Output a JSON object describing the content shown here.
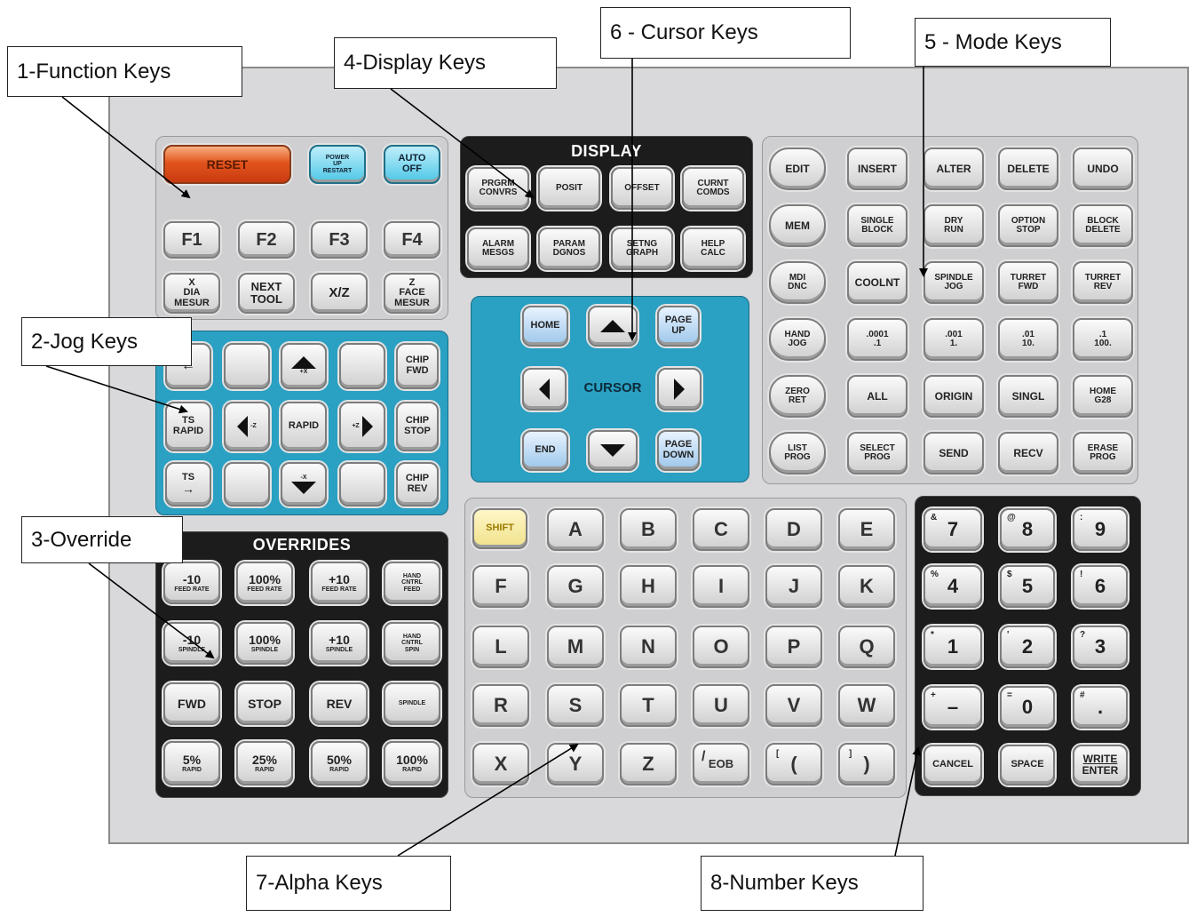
{
  "callouts": {
    "function": "1-Function Keys",
    "jog": "2-Jog Keys",
    "override": "3-Override",
    "display": "4-Display Keys",
    "mode": "5 - Mode Keys",
    "cursor": "6 - Cursor Keys",
    "alpha": "7-Alpha Keys",
    "number": "8-Number Keys"
  },
  "function_keys": {
    "reset": "RESET",
    "power_up_top": "POWER",
    "power_up_mid": "UP",
    "power_up_bot": "RESTART",
    "auto_off_top": "AUTO",
    "auto_off_bot": "OFF",
    "f1": "F1",
    "f2": "F2",
    "f3": "F3",
    "f4": "F4",
    "x_dia_mesur": [
      "X",
      "DIA",
      "MESUR"
    ],
    "next_tool": [
      "NEXT",
      "TOOL"
    ],
    "xz": "X/Z",
    "z_face_mesur": [
      "Z",
      "FACE",
      "MESUR"
    ]
  },
  "display_keys": {
    "title": "DISPLAY",
    "keys": [
      [
        "PRGRM",
        "CONVRS"
      ],
      [
        "POSIT"
      ],
      [
        "OFFSET"
      ],
      [
        "CURNT",
        "COMDS"
      ],
      [
        "ALARM",
        "MESGS"
      ],
      [
        "PARAM",
        "DGNOS"
      ],
      [
        "SETNG",
        "GRAPH"
      ],
      [
        "HELP",
        "CALC"
      ]
    ]
  },
  "cursor_keys": {
    "home": "HOME",
    "page_up": [
      "PAGE",
      "UP"
    ],
    "label": "CURSOR",
    "end": "END",
    "page_down": [
      "PAGE",
      "DOWN"
    ]
  },
  "mode_keys": {
    "rows": [
      [
        [
          "EDIT"
        ],
        [
          "INSERT"
        ],
        [
          "ALTER"
        ],
        [
          "DELETE"
        ],
        [
          "UNDO"
        ]
      ],
      [
        [
          "MEM"
        ],
        [
          "SINGLE",
          "BLOCK"
        ],
        [
          "DRY",
          "RUN"
        ],
        [
          "OPTION",
          "STOP"
        ],
        [
          "BLOCK",
          "DELETE"
        ]
      ],
      [
        [
          "MDI",
          "DNC"
        ],
        [
          "COOLNT"
        ],
        [
          "SPINDLE",
          "JOG"
        ],
        [
          "TURRET",
          "FWD"
        ],
        [
          "TURRET",
          "REV"
        ]
      ],
      [
        [
          "HAND",
          "JOG"
        ],
        [
          ".0001",
          ".1"
        ],
        [
          ".001",
          "1."
        ],
        [
          ".01",
          "10."
        ],
        [
          ".1",
          "100."
        ]
      ],
      [
        [
          "ZERO",
          "RET"
        ],
        [
          "ALL"
        ],
        [
          "ORIGIN"
        ],
        [
          "SINGL"
        ],
        [
          "HOME",
          "G28"
        ]
      ],
      [
        [
          "LIST",
          "PROG"
        ],
        [
          "SELECT",
          "PROG"
        ],
        [
          "SEND"
        ],
        [
          "RECV"
        ],
        [
          "ERASE",
          "PROG"
        ]
      ]
    ]
  },
  "jog_keys": {
    "plus_x": "+X",
    "minus_x": "-X",
    "minus_z": "-Z",
    "plus_z": "+Z",
    "rapid": "RAPID",
    "ts_rapid": [
      "TS",
      "RAPID"
    ],
    "ts": "TS",
    "chip_fwd": [
      "CHIP",
      "FWD"
    ],
    "chip_stop": [
      "CHIP",
      "STOP"
    ],
    "chip_rev": [
      "CHIP",
      "REV"
    ]
  },
  "override_keys": {
    "title": "OVERRIDES",
    "rows": [
      [
        [
          "-10",
          "FEED RATE"
        ],
        [
          "100%",
          "FEED RATE"
        ],
        [
          "+10",
          "FEED RATE"
        ],
        [
          "HAND",
          "CNTRL",
          "FEED"
        ]
      ],
      [
        [
          "-10",
          "SPINDLE"
        ],
        [
          "100%",
          "SPINDLE"
        ],
        [
          "+10",
          "SPINDLE"
        ],
        [
          "HAND",
          "CNTRL",
          "SPIN"
        ]
      ],
      [
        [
          "FWD"
        ],
        [
          "STOP"
        ],
        [
          "REV"
        ],
        [
          "SPINDLE"
        ]
      ],
      [
        [
          "5%",
          "RAPID"
        ],
        [
          "25%",
          "RAPID"
        ],
        [
          "50%",
          "RAPID"
        ],
        [
          "100%",
          "RAPID"
        ]
      ]
    ]
  },
  "alpha_keys": {
    "shift": "SHIFT",
    "rows": [
      [
        "A",
        "B",
        "C",
        "D",
        "E"
      ],
      [
        "F",
        "G",
        "H",
        "I",
        "J",
        "K"
      ],
      [
        "L",
        "M",
        "N",
        "O",
        "P",
        "Q"
      ],
      [
        "R",
        "S",
        "T",
        "U",
        "V",
        "W"
      ],
      [
        "X",
        "Y",
        "Z",
        "EOB",
        "(",
        ")"
      ]
    ],
    "eob_sup": "/",
    "lparen_sup": "[",
    "rparen_sup": "]"
  },
  "number_keys": {
    "rows": [
      [
        [
          "7",
          "&"
        ],
        [
          "8",
          "@"
        ],
        [
          "9",
          ":"
        ]
      ],
      [
        [
          "4",
          "%"
        ],
        [
          "5",
          "$"
        ],
        [
          "6",
          "!"
        ]
      ],
      [
        [
          "1",
          "*"
        ],
        [
          "2",
          "'"
        ],
        [
          "3",
          "?"
        ]
      ],
      [
        [
          "–",
          "+"
        ],
        [
          "0",
          "="
        ],
        [
          ".",
          "#"
        ]
      ]
    ],
    "cancel": "CANCEL",
    "space": "SPACE",
    "write": "WRITE",
    "enter": "ENTER"
  }
}
